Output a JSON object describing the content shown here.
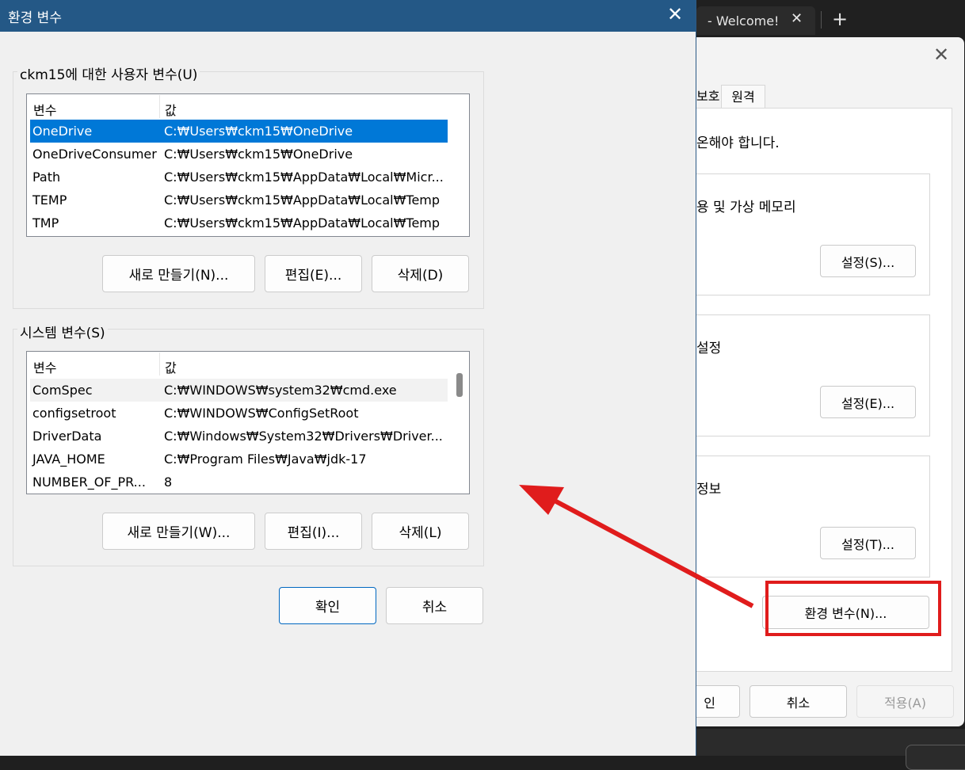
{
  "terminal": {
    "tab_title": "- Welcome!",
    "close_glyph": "✕",
    "plus_glyph": "+"
  },
  "system_properties": {
    "close_glyph": "✕",
    "tabs": [
      "보호",
      "원격"
    ],
    "notice_fragment": "로그온해야 합니다.",
    "notice_visible": "온해야 합니다.",
    "performance_label": "용 및 가상 메모리",
    "profile_label": "설정",
    "startup_label": "정보",
    "settings_buttons": [
      "설정(S)...",
      "설정(E)...",
      "설정(T)..."
    ],
    "env_button": "환경 변수(N)...",
    "bottom_buttons": {
      "ok_visible": "인",
      "cancel": "취소",
      "apply": "적용(A)"
    }
  },
  "dialog": {
    "title": "환경 변수",
    "close_glyph": "✕",
    "user_group": {
      "label": "ckm15에 대한 사용자 변수(U)",
      "headers": [
        "변수",
        "값"
      ],
      "rows": [
        {
          "name": "OneDrive",
          "value": "C:₩Users₩ckm15₩OneDrive"
        },
        {
          "name": "OneDriveConsumer",
          "value": "C:₩Users₩ckm15₩OneDrive"
        },
        {
          "name": "Path",
          "value": "C:₩Users₩ckm15₩AppData₩Local₩Micr..."
        },
        {
          "name": "TEMP",
          "value": "C:₩Users₩ckm15₩AppData₩Local₩Temp"
        },
        {
          "name": "TMP",
          "value": "C:₩Users₩ckm15₩AppData₩Local₩Temp"
        }
      ],
      "buttons": {
        "new": "새로 만들기(N)...",
        "edit": "편집(E)...",
        "delete": "삭제(D)"
      }
    },
    "system_group": {
      "label": "시스템 변수(S)",
      "headers": [
        "변수",
        "값"
      ],
      "rows": [
        {
          "name": "ComSpec",
          "value": "C:₩WINDOWS₩system32₩cmd.exe"
        },
        {
          "name": "configsetroot",
          "value": "C:₩WINDOWS₩ConfigSetRoot"
        },
        {
          "name": "DriverData",
          "value": "C:₩Windows₩System32₩Drivers₩Driver..."
        },
        {
          "name": "JAVA_HOME",
          "value": "C:₩Program Files₩Java₩jdk-17"
        },
        {
          "name": "NUMBER_OF_PR...",
          "value": "8"
        }
      ],
      "buttons": {
        "new": "새로 만들기(W)...",
        "edit": "편집(I)...",
        "delete": "삭제(L)"
      }
    },
    "ok_label": "확인",
    "cancel_label": "취소"
  },
  "colors": {
    "title_bar": "#245886",
    "selection": "#0078d7",
    "annotation_red": "#e01c1c"
  }
}
